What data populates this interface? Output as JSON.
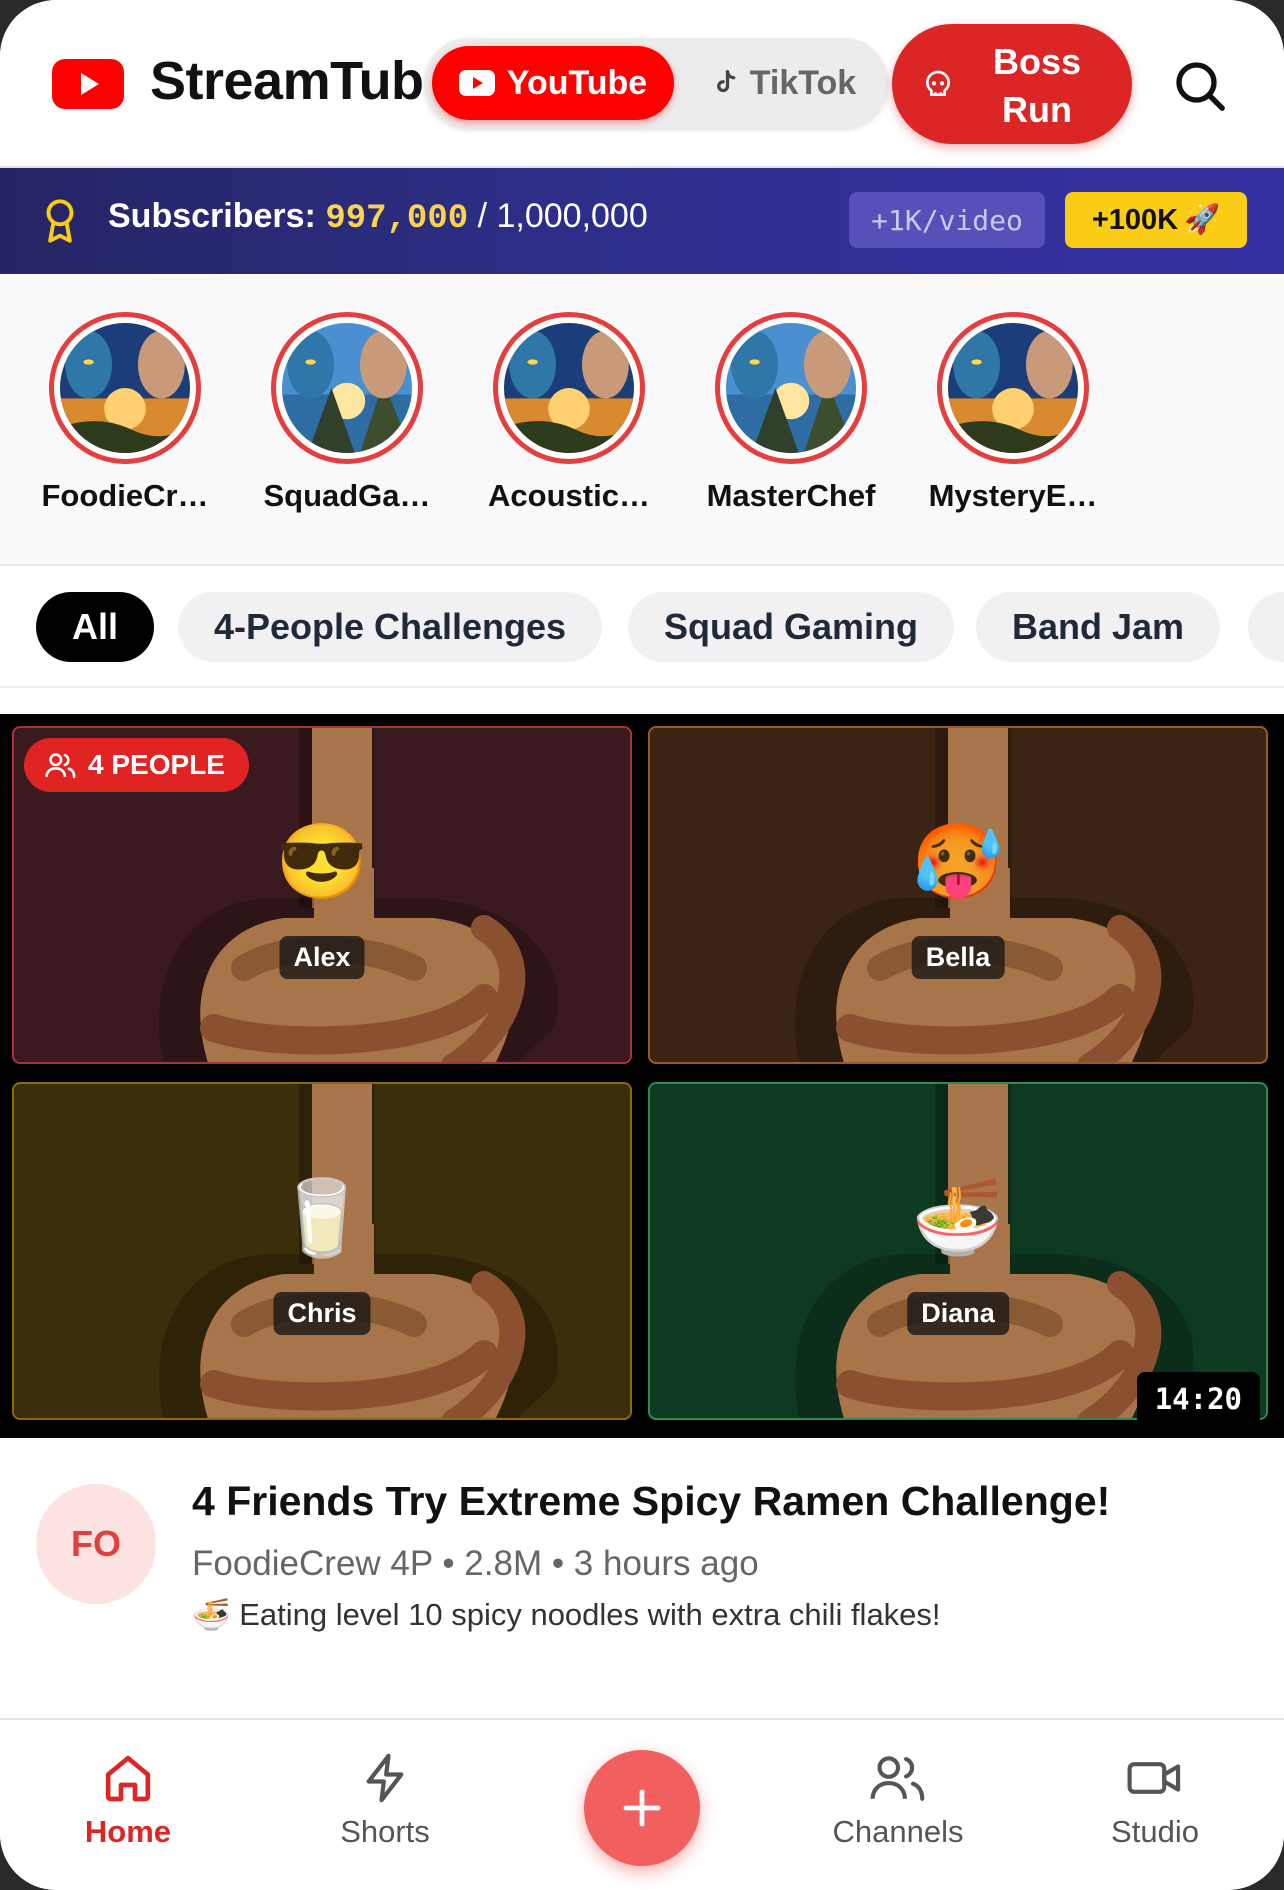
{
  "header": {
    "app_title": "StreamTube",
    "platforms": [
      {
        "label": "YouTube",
        "selected": true
      },
      {
        "label": "TikTok",
        "selected": false
      }
    ],
    "boss_label": "Boss Run"
  },
  "subscribers": {
    "label": "Subscribers:",
    "count": "997,000",
    "total": "/ 1,000,000",
    "rate": "+1K/video",
    "boost_label": "+100K",
    "boost_emoji": "🚀"
  },
  "stories": [
    {
      "name": "FoodieCr…"
    },
    {
      "name": "SquadGa…"
    },
    {
      "name": "Acoustic…"
    },
    {
      "name": "MasterChef"
    },
    {
      "name": "MysteryE…"
    }
  ],
  "chips": [
    {
      "label": "All",
      "active": true
    },
    {
      "label": "4-People Challenges",
      "active": false
    },
    {
      "label": "Squad Gaming",
      "active": false
    },
    {
      "label": "Band Jam",
      "active": false
    }
  ],
  "video": {
    "people_badge": "4 PEOPLE",
    "participants": [
      {
        "name": "Alex",
        "emoji": "😎"
      },
      {
        "name": "Bella",
        "emoji": "🥵"
      },
      {
        "name": "Chris",
        "emoji": "🥛"
      },
      {
        "name": "Diana",
        "emoji": "🍜"
      }
    ],
    "duration": "14:20",
    "channel_initials": "FO",
    "title": "4 Friends Try Extreme Spicy Ramen Challenge!",
    "meta": "FoodieCrew 4P • 2.8M • 3 hours ago",
    "description_emoji": "🍜",
    "description": "Eating level 10 spicy noodles with extra chili flakes!"
  },
  "nav": {
    "items": [
      {
        "label": "Home",
        "icon": "home-icon",
        "active": true
      },
      {
        "label": "Shorts",
        "icon": "bolt-icon",
        "active": false
      },
      {
        "label": "Channels",
        "icon": "users-icon",
        "active": false
      },
      {
        "label": "Studio",
        "icon": "video-camera-icon",
        "active": false
      }
    ],
    "create_icon": "plus-icon"
  },
  "colors": {
    "brand_red": "#ff0000",
    "accent_red": "#dc2626",
    "subbar_start": "#252563",
    "subbar_end": "#3730a3",
    "gold": "#facc15"
  }
}
